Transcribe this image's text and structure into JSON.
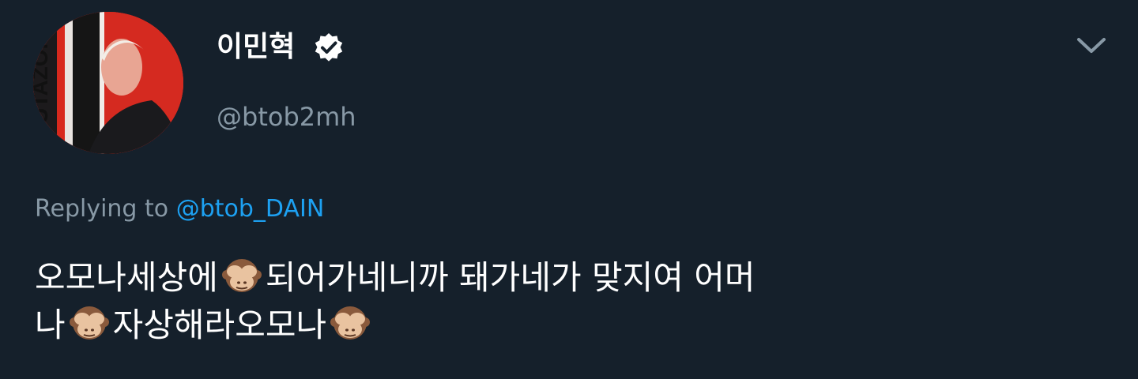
{
  "user": {
    "display_name": "이민혁",
    "handle": "@btob2mh",
    "avatar_text": "HUTAZONE",
    "verified_icon": "verified-badge-icon"
  },
  "reply": {
    "prefix": "Replying to",
    "mention": "@btob_DAIN"
  },
  "tweet": {
    "line1_part1": "오모나세상에",
    "line1_part2": "되어가네니까 돼가네가 맞지여 어머",
    "line2_part1": "나",
    "line2_part2": "자상해라오모나",
    "emoji_icon": "see-no-evil-monkey-icon"
  },
  "menu": {
    "icon": "chevron-down-icon"
  },
  "colors": {
    "background": "#15202b",
    "secondary_text": "#8899a6",
    "link": "#1da1f2",
    "avatar_red": "#d8291d"
  }
}
